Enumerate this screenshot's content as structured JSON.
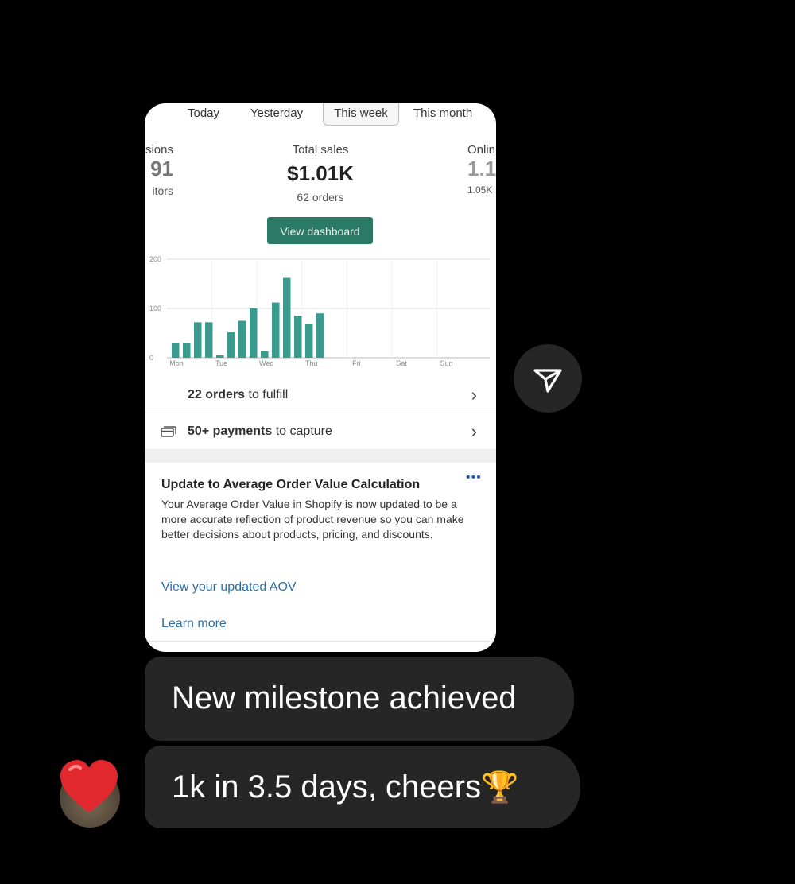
{
  "tabs": [
    "Today",
    "Yesterday",
    "This week",
    "This month"
  ],
  "active_tab": "This week",
  "metrics": {
    "left": {
      "label": "sions",
      "value": "91",
      "sub": "itors"
    },
    "center": {
      "label": "Total sales",
      "value": "$1.01K",
      "sub": "62 orders"
    },
    "right": {
      "label": "Onlin",
      "value": "1.1",
      "sub": "1.05K"
    }
  },
  "dashboard_button": "View dashboard",
  "chart_data": {
    "type": "bar",
    "y_ticks": [
      "200",
      "100",
      "0"
    ],
    "ylim": [
      0,
      200
    ],
    "categories": [
      "Mon",
      "Tue",
      "Wed",
      "Thu",
      "Fri",
      "Sat",
      "Sun"
    ],
    "values": [
      30,
      30,
      72,
      72,
      5,
      52,
      75,
      100,
      13,
      112,
      162,
      85,
      68,
      90
    ],
    "grid": true,
    "bar_color": "#3a9a8e"
  },
  "rows": {
    "fulfill": {
      "bold": "22 orders",
      "rest": " to fulfill"
    },
    "payments": {
      "bold": "50+ payments",
      "rest": " to capture"
    }
  },
  "aov": {
    "title": "Update to Average Order Value Calculation",
    "body": "Your Average Order Value in Shopify is now updated to be a more accurate reflection of product revenue so you can make better decisions about products, pricing, and discounts.",
    "link1": "View your updated AOV",
    "link2": "Learn more",
    "more_icon": "•••"
  },
  "messages": [
    {
      "text": "New milestone achieved"
    },
    {
      "text": "1k in 3.5 days, cheers",
      "emoji": "🏆"
    }
  ],
  "reaction": "❤️",
  "colors": {
    "accent": "#2a7a65",
    "bubble": "#262626",
    "link": "#2c6ea6"
  }
}
